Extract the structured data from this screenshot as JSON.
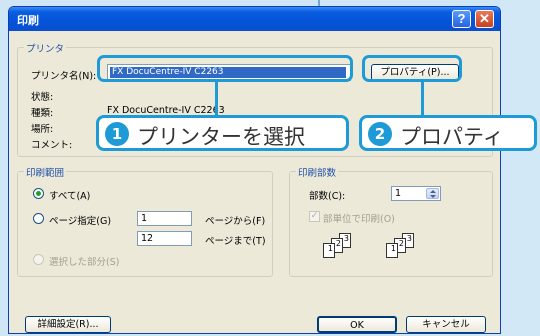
{
  "window": {
    "title": "印刷"
  },
  "printer_group": {
    "label": "プリンタ",
    "name_label": "プリンタ名(N):",
    "selected_printer": "FX DocuCentre-IV C2263",
    "properties_button": "プロパティ(P)...",
    "status_label": "状態:",
    "type_label": "種類:",
    "type_value": "FX DocuCentre-IV C2263",
    "location_label": "場所:",
    "comment_label": "コメント:"
  },
  "callouts": [
    {
      "num": "1",
      "text": "プリンターを選択"
    },
    {
      "num": "2",
      "text": "プロパティ"
    }
  ],
  "range_group": {
    "label": "印刷範囲",
    "all": "すべて(A)",
    "pages": "ページ指定(G)",
    "from_value": "1",
    "from_label": "ページから(F)",
    "to_value": "12",
    "to_label": "ページまで(T)",
    "selection": "選択した部分(S)"
  },
  "copies_group": {
    "label": "印刷部数",
    "copies_label": "部数(C):",
    "copies_value": "1",
    "collate_label": "部単位で印刷(O)",
    "collate_pages": [
      "1",
      "2",
      "3"
    ]
  },
  "footer": {
    "detail_button": "詳細設定(R)...",
    "ok_button": "OK",
    "cancel_button": "キャンセル"
  }
}
